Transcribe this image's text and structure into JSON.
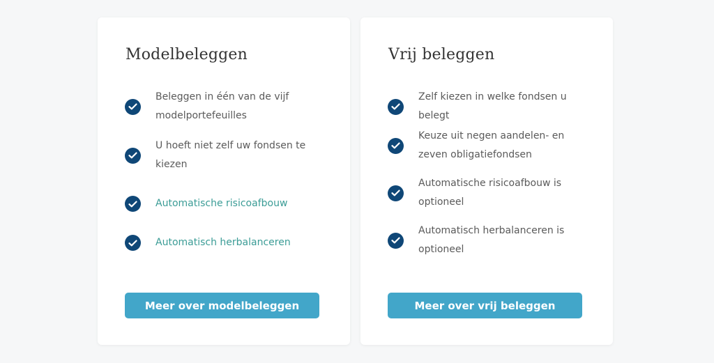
{
  "cards": [
    {
      "title": "Modelbeleggen",
      "features": [
        {
          "text": "Beleggen in één van de vijf modelportefeuilles"
        },
        {
          "text": "U hoeft niet zelf uw fondsen te kiezen"
        },
        {
          "text": "Automatische risicoafbouw"
        },
        {
          "text": "Automatisch herbalanceren"
        }
      ],
      "button_label": "Meer over modelbeleggen"
    },
    {
      "title": "Vrij beleggen",
      "features": [
        {
          "text": "Zelf kiezen in welke fondsen u belegt"
        },
        {
          "text": "Keuze uit negen aandelen- en zeven obligatiefondsen"
        },
        {
          "text": "Automatische risicoafbouw is optioneel"
        },
        {
          "text": "Automatisch herbalanceren is optioneel"
        }
      ],
      "button_label": "Meer over vrij beleggen"
    }
  ],
  "icons": {
    "feature_bullet": "check-circle-icon"
  },
  "colors": {
    "check": "#0f4777",
    "accent_text": "#3b9c96",
    "button": "#42a6c9",
    "page_background": "#f6f7f8"
  }
}
